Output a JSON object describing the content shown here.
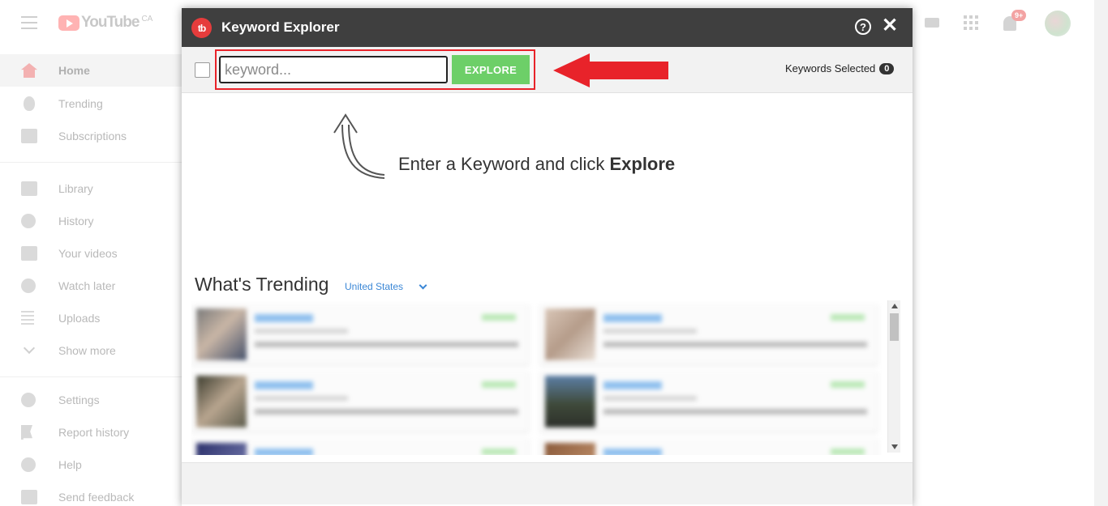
{
  "youtube": {
    "logo_word": "YouTube",
    "logo_region": "CA",
    "notification_count": "9+",
    "sidebar": {
      "items": [
        {
          "label": "Home",
          "icon": "home-icon"
        },
        {
          "label": "Trending",
          "icon": "flame-icon"
        },
        {
          "label": "Subscriptions",
          "icon": "subscriptions-icon"
        },
        {
          "label": "Library",
          "icon": "library-icon"
        },
        {
          "label": "History",
          "icon": "history-icon"
        },
        {
          "label": "Your videos",
          "icon": "your-videos-icon"
        },
        {
          "label": "Watch later",
          "icon": "clock-icon"
        },
        {
          "label": "Uploads",
          "icon": "playlist-icon"
        },
        {
          "label": "Show more",
          "icon": "chevron-down-icon"
        },
        {
          "label": "Settings",
          "icon": "gear-icon"
        },
        {
          "label": "Report history",
          "icon": "flag-icon"
        },
        {
          "label": "Help",
          "icon": "help-icon"
        },
        {
          "label": "Send feedback",
          "icon": "feedback-icon"
        }
      ]
    }
  },
  "modal": {
    "logo_text": "tb",
    "title": "Keyword Explorer",
    "help_glyph": "?",
    "close_glyph": "✕",
    "search": {
      "placeholder": "keyword...",
      "value": "",
      "button_label": "EXPLORE"
    },
    "keywords_selected_label": "Keywords Selected",
    "keywords_selected_count": "0",
    "hint": {
      "prefix": "Enter a Keyword and click ",
      "emphasis": "Explore"
    },
    "trending": {
      "title": "What's Trending",
      "country": "United States"
    }
  },
  "colors": {
    "modal_header": "#3f3f3f",
    "explore_button": "#6dcf68",
    "annotation_red": "#e8232a",
    "link_blue": "#3b87d6",
    "brand_red": "#e63c3c"
  }
}
